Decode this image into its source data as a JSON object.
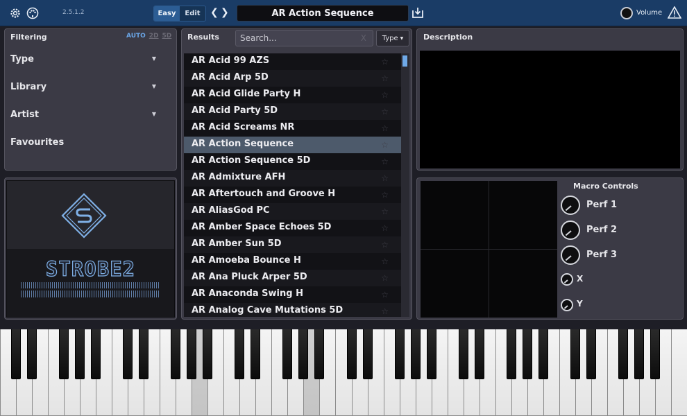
{
  "app": {
    "version": "2.5.1.2",
    "mode_easy": "Easy",
    "mode_edit": "Edit",
    "preset_name": "AR Action Sequence",
    "volume_label": "Volume"
  },
  "filtering": {
    "title": "Filtering",
    "modes": [
      "AUTO",
      "2D",
      "5D"
    ],
    "rows": [
      "Type",
      "Library",
      "Artist",
      "Favourites"
    ]
  },
  "logo": {
    "text": "STROBE2"
  },
  "results": {
    "title": "Results",
    "search_placeholder": "Search...",
    "search_clear": "X",
    "type_button": "Type",
    "selected_index": 5,
    "items": [
      "AR Acid 99 AZS",
      "AR Acid Arp 5D",
      "AR Acid Glide Party H",
      "AR Acid Party 5D",
      "AR Acid Screams NR",
      "AR Action Sequence",
      "AR Action Sequence 5D",
      "AR Admixture AFH",
      "AR Aftertouch and Groove H",
      "AR AliasGod PC",
      "AR Amber Space Echoes 5D",
      "AR Amber Sun 5D",
      "AR Amoeba Bounce H",
      "AR Ana Pluck Arper 5D",
      "AR Anaconda Swing H",
      "AR Analog Cave Mutations 5D"
    ]
  },
  "description": {
    "title": "Description"
  },
  "macros": {
    "title": "Macro Controls",
    "controls": [
      "Perf 1",
      "Perf 2",
      "Perf 3",
      "X",
      "Y"
    ]
  },
  "colors": {
    "accent": "#6aa5e6",
    "topbar": "#1a3c66",
    "panel": "#3b3a45"
  }
}
